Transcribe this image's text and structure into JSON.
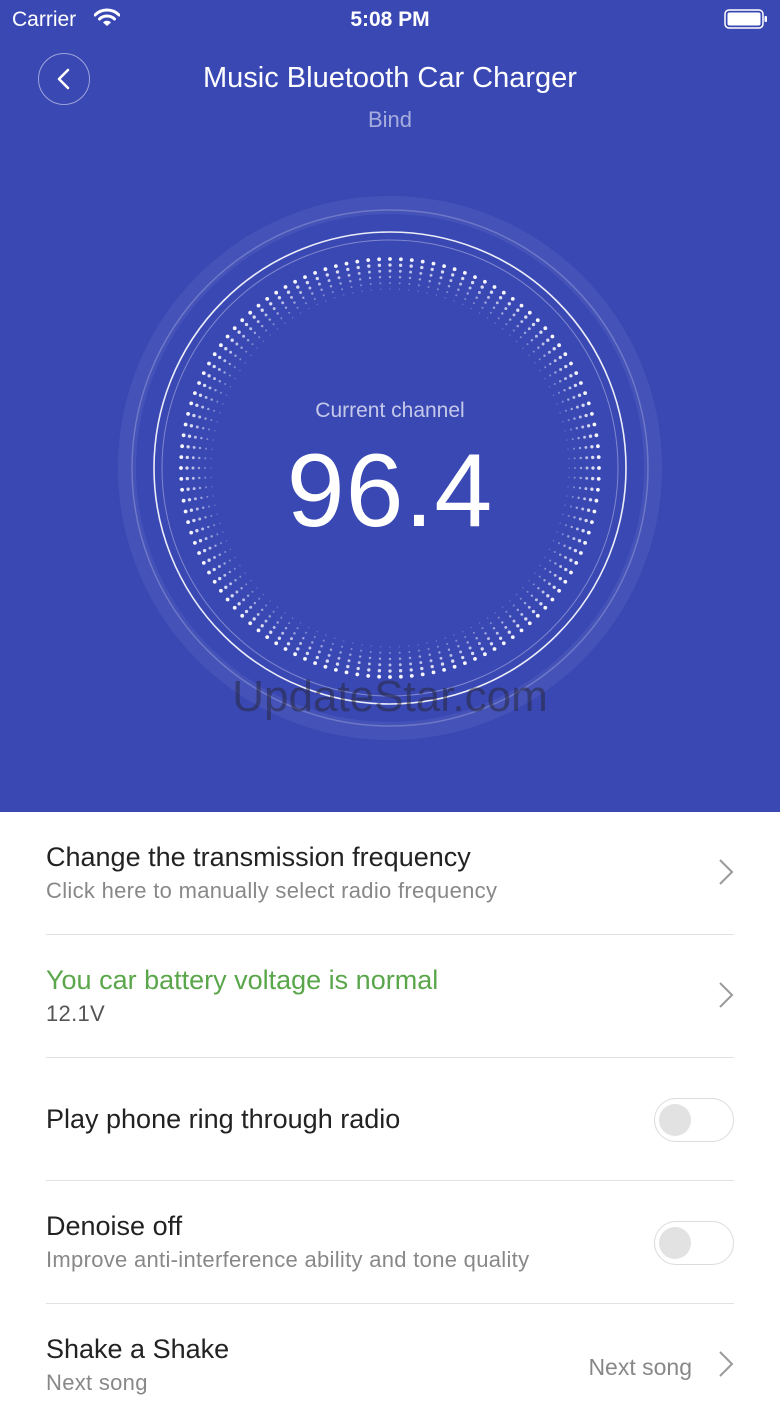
{
  "status_bar": {
    "carrier": "Carrier",
    "time": "5:08 PM"
  },
  "header": {
    "title": "Music Bluetooth Car Charger",
    "subtitle": "Bind"
  },
  "dial": {
    "label": "Current channel",
    "value": "96.4"
  },
  "watermark": "UpdateStar.com",
  "settings": {
    "frequency": {
      "title": "Change the transmission frequency",
      "subtitle": "Click here to manually select radio frequency"
    },
    "battery": {
      "title": "You car battery voltage is normal",
      "subtitle": "12.1V",
      "status_color": "#5aa64a"
    },
    "ring": {
      "title": "Play phone ring through radio",
      "enabled": false
    },
    "denoise": {
      "title": "Denoise off",
      "subtitle": "Improve anti-interference ability and tone quality",
      "enabled": false
    },
    "shake": {
      "title": "Shake a Shake",
      "subtitle": "Next song",
      "value": "Next song"
    }
  },
  "colors": {
    "hero_background": "#3a48b4",
    "accent_green": "#5aa64a"
  }
}
